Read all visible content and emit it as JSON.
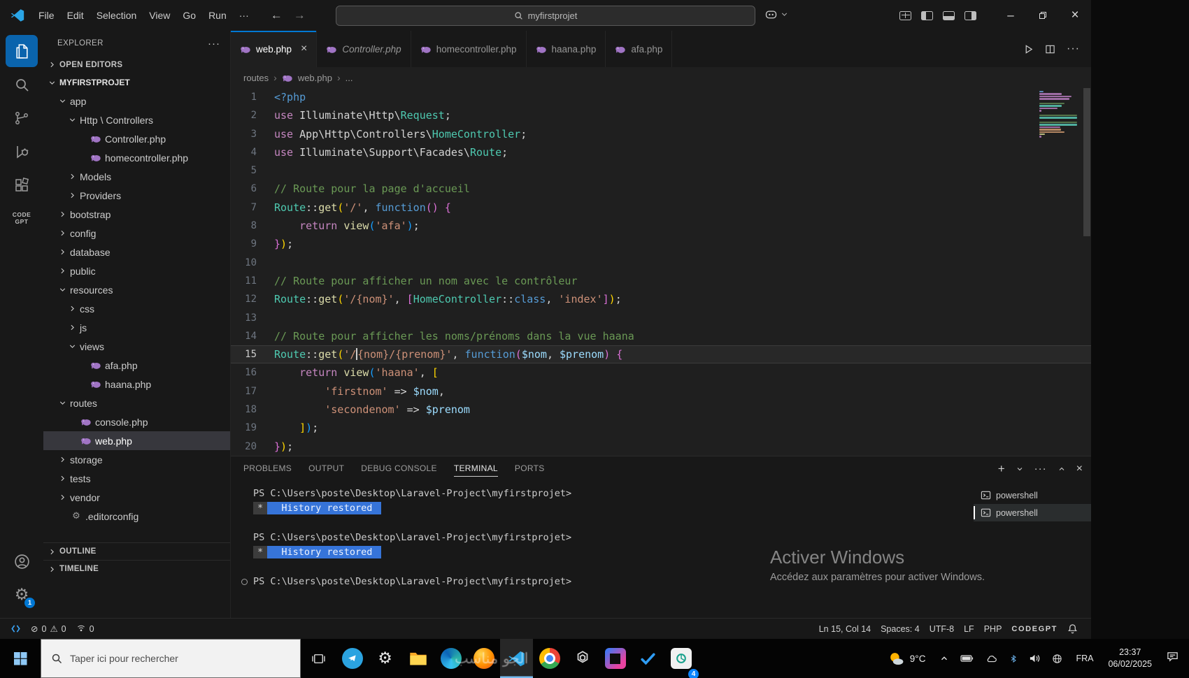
{
  "titlebar": {
    "menus": [
      "File",
      "Edit",
      "Selection",
      "View",
      "Go",
      "Run",
      "···"
    ],
    "search_label": "myfirstprojet",
    "back_arrow": "←",
    "forward_arrow": "→",
    "minimize": "–",
    "close": "×"
  },
  "activitybar": {
    "items": [
      {
        "name": "explorer",
        "icon": "files-icon",
        "active": true
      },
      {
        "name": "search",
        "icon": "search-icon"
      },
      {
        "name": "source-control",
        "icon": "source-control-icon"
      },
      {
        "name": "run-debug",
        "icon": "run-debug-icon"
      },
      {
        "name": "extensions",
        "icon": "extensions-icon"
      },
      {
        "name": "codegpt",
        "icon": "codegpt-icon",
        "label": "CODE GPT"
      }
    ],
    "bottom": [
      {
        "name": "account",
        "icon": "account-icon"
      },
      {
        "name": "settings",
        "icon": "gear-icon",
        "badge": "1"
      }
    ]
  },
  "sidebar": {
    "title": "EXPLORER",
    "more": "···",
    "open_editors": "OPEN EDITORS",
    "root": "MYFIRSTPROJET",
    "outline": "OUTLINE",
    "timeline": "TIMELINE",
    "tree": [
      {
        "label": "app",
        "indent": 1,
        "chevron": "down"
      },
      {
        "label": "Http \\ Controllers",
        "indent": 2,
        "chevron": "down"
      },
      {
        "label": "Controller.php",
        "indent": 3,
        "icon": "php-icon"
      },
      {
        "label": "homecontroller.php",
        "indent": 3,
        "icon": "php-icon"
      },
      {
        "label": "Models",
        "indent": 2,
        "chevron": "right"
      },
      {
        "label": "Providers",
        "indent": 2,
        "chevron": "right"
      },
      {
        "label": "bootstrap",
        "indent": 1,
        "chevron": "right"
      },
      {
        "label": "config",
        "indent": 1,
        "chevron": "right"
      },
      {
        "label": "database",
        "indent": 1,
        "chevron": "right"
      },
      {
        "label": "public",
        "indent": 1,
        "chevron": "right"
      },
      {
        "label": "resources",
        "indent": 1,
        "chevron": "down"
      },
      {
        "label": "css",
        "indent": 2,
        "chevron": "right"
      },
      {
        "label": "js",
        "indent": 2,
        "chevron": "right"
      },
      {
        "label": "views",
        "indent": 2,
        "chevron": "down"
      },
      {
        "label": "afa.php",
        "indent": 3,
        "icon": "php-icon"
      },
      {
        "label": "haana.php",
        "indent": 3,
        "icon": "php-icon"
      },
      {
        "label": "routes",
        "indent": 1,
        "chevron": "down"
      },
      {
        "label": "console.php",
        "indent": 2,
        "icon": "php-icon"
      },
      {
        "label": "web.php",
        "indent": 2,
        "icon": "php-icon",
        "selected": true
      },
      {
        "label": "storage",
        "indent": 1,
        "chevron": "right"
      },
      {
        "label": "tests",
        "indent": 1,
        "chevron": "right"
      },
      {
        "label": "vendor",
        "indent": 1,
        "chevron": "right"
      },
      {
        "label": ".editorconfig",
        "indent": 1,
        "icon": "gear-file-icon"
      }
    ]
  },
  "editor": {
    "tabs": [
      {
        "label": "web.php",
        "active": true
      },
      {
        "label": "Controller.php",
        "italic": true
      },
      {
        "label": "homecontroller.php"
      },
      {
        "label": "haana.php"
      },
      {
        "label": "afa.php"
      }
    ],
    "breadcrumb": [
      "routes",
      "web.php",
      "..."
    ],
    "active_line": 15,
    "lines": [
      [
        [
          "kwb",
          "<?php"
        ]
      ],
      [
        [
          "kwp",
          "use"
        ],
        [
          "txt",
          " Illuminate\\Http\\"
        ],
        [
          "cls",
          "Request"
        ],
        [
          "txt",
          ";"
        ]
      ],
      [
        [
          "kwp",
          "use"
        ],
        [
          "txt",
          " App\\Http\\Controllers\\"
        ],
        [
          "cls",
          "HomeController"
        ],
        [
          "txt",
          ";"
        ]
      ],
      [
        [
          "kwp",
          "use"
        ],
        [
          "txt",
          " Illuminate\\Support\\Facades\\"
        ],
        [
          "cls",
          "Route"
        ],
        [
          "txt",
          ";"
        ]
      ],
      [],
      [
        [
          "cmt",
          "// Route pour la page d'accueil"
        ]
      ],
      [
        [
          "cls",
          "Route"
        ],
        [
          "txt",
          "::"
        ],
        [
          "fn",
          "get"
        ],
        [
          "b1",
          "("
        ],
        [
          "str",
          "'/'"
        ],
        [
          "txt",
          ", "
        ],
        [
          "kwb",
          "function"
        ],
        [
          "b2",
          "()"
        ],
        [
          "txt",
          " "
        ],
        [
          "b2",
          "{"
        ]
      ],
      [
        [
          "txt",
          "    "
        ],
        [
          "kwp",
          "return"
        ],
        [
          "txt",
          " "
        ],
        [
          "fn",
          "view"
        ],
        [
          "b3",
          "("
        ],
        [
          "str",
          "'afa'"
        ],
        [
          "b3",
          ")"
        ],
        [
          "txt",
          ";"
        ]
      ],
      [
        [
          "b2",
          "}"
        ],
        [
          "b1",
          ")"
        ],
        [
          "txt",
          ";"
        ]
      ],
      [],
      [
        [
          "cmt",
          "// Route pour afficher un nom avec le contrôleur"
        ]
      ],
      [
        [
          "cls",
          "Route"
        ],
        [
          "txt",
          "::"
        ],
        [
          "fn",
          "get"
        ],
        [
          "b1",
          "("
        ],
        [
          "str",
          "'/{nom}'"
        ],
        [
          "txt",
          ", "
        ],
        [
          "b2",
          "["
        ],
        [
          "cls",
          "HomeController"
        ],
        [
          "txt",
          "::"
        ],
        [
          "kwb",
          "class"
        ],
        [
          "txt",
          ", "
        ],
        [
          "str",
          "'index'"
        ],
        [
          "b2",
          "]"
        ],
        [
          "b1",
          ")"
        ],
        [
          "txt",
          ";"
        ]
      ],
      [],
      [
        [
          "cmt",
          "// Route pour afficher les noms/prénoms dans la vue haana"
        ]
      ],
      [
        [
          "cls",
          "Route"
        ],
        [
          "txt",
          "::"
        ],
        [
          "fn",
          "get"
        ],
        [
          "b1",
          "("
        ],
        [
          "str",
          "'/"
        ],
        [
          "cur",
          ""
        ],
        [
          "str",
          "{nom}/{prenom}'"
        ],
        [
          "txt",
          ", "
        ],
        [
          "kwb",
          "function"
        ],
        [
          "b2",
          "("
        ],
        [
          "var",
          "$nom"
        ],
        [
          "txt",
          ", "
        ],
        [
          "var",
          "$prenom"
        ],
        [
          "b2",
          ")"
        ],
        [
          "txt",
          " "
        ],
        [
          "b2",
          "{"
        ]
      ],
      [
        [
          "txt",
          "    "
        ],
        [
          "kwp",
          "return"
        ],
        [
          "txt",
          " "
        ],
        [
          "fn",
          "view"
        ],
        [
          "b3",
          "("
        ],
        [
          "str",
          "'haana'"
        ],
        [
          "txt",
          ", "
        ],
        [
          "b1",
          "["
        ]
      ],
      [
        [
          "txt",
          "        "
        ],
        [
          "str",
          "'firstnom'"
        ],
        [
          "txt",
          " => "
        ],
        [
          "var",
          "$nom"
        ],
        [
          "txt",
          ","
        ]
      ],
      [
        [
          "txt",
          "        "
        ],
        [
          "str",
          "'secondenom'"
        ],
        [
          "txt",
          " => "
        ],
        [
          "var",
          "$prenom"
        ]
      ],
      [
        [
          "txt",
          "    "
        ],
        [
          "b1",
          "]"
        ],
        [
          "b3",
          ")"
        ],
        [
          "txt",
          ";"
        ]
      ],
      [
        [
          "b2",
          "}"
        ],
        [
          "b1",
          ")"
        ],
        [
          "txt",
          ";"
        ]
      ]
    ]
  },
  "panel": {
    "tabs": [
      "PROBLEMS",
      "OUTPUT",
      "DEBUG CONSOLE",
      "TERMINAL",
      "PORTS"
    ],
    "active_tab": "TERMINAL",
    "terminal": {
      "prompt": "PS C:\\Users\\poste\\Desktop\\Laravel-Project\\myfirstprojet>",
      "history_badge": "*",
      "history_text": "History restored",
      "rows": [
        {
          "type": "prompt"
        },
        {
          "type": "history"
        },
        {
          "type": "blank"
        },
        {
          "type": "prompt"
        },
        {
          "type": "history"
        },
        {
          "type": "blank"
        },
        {
          "type": "prompt",
          "decorated": true
        }
      ],
      "list": [
        {
          "label": "powershell"
        },
        {
          "label": "powershell",
          "active": true
        }
      ]
    },
    "watermark": {
      "title": "Activer Windows",
      "subtitle": "Accédez aux paramètres pour activer Windows."
    }
  },
  "statusbar": {
    "errors": "0",
    "warnings": "0",
    "ports": "0",
    "right": [
      {
        "name": "cursor-position",
        "label": "Ln 15, Col 14"
      },
      {
        "name": "indentation",
        "label": "Spaces: 4"
      },
      {
        "name": "encoding",
        "label": "UTF-8"
      },
      {
        "name": "eol",
        "label": "LF"
      },
      {
        "name": "language",
        "label": "PHP"
      },
      {
        "name": "codegpt",
        "label": "CODEGPT"
      }
    ]
  },
  "taskbar": {
    "search_placeholder": "Taper ici pour rechercher",
    "overlay_text": "الجو مناسب",
    "apps": [
      {
        "name": "telegram",
        "icon": "telegram-icon"
      },
      {
        "name": "settings",
        "icon": "gear-icon"
      },
      {
        "name": "file-explorer",
        "icon": "folder-icon"
      },
      {
        "name": "edge",
        "icon": "edge-icon"
      },
      {
        "name": "firefox",
        "icon": "firefox-icon"
      },
      {
        "name": "vscode",
        "icon": "vscode-icon",
        "active": true
      },
      {
        "name": "chrome",
        "icon": "chrome-icon"
      },
      {
        "name": "openai",
        "icon": "openai-icon"
      },
      {
        "name": "jetbrains",
        "icon": "jetbrains-icon"
      },
      {
        "name": "check-app",
        "icon": "check-icon"
      },
      {
        "name": "gpt4",
        "icon": "gpt4-icon",
        "badge": "4"
      }
    ],
    "weather_temp": "9°C",
    "tray": [
      "chevron-up-icon",
      "battery-icon",
      "cloud-icon",
      "bluetooth-icon",
      "volume-icon",
      "network-icon"
    ],
    "language": "FRA",
    "time": "23:37",
    "date": "06/02/2025"
  }
}
